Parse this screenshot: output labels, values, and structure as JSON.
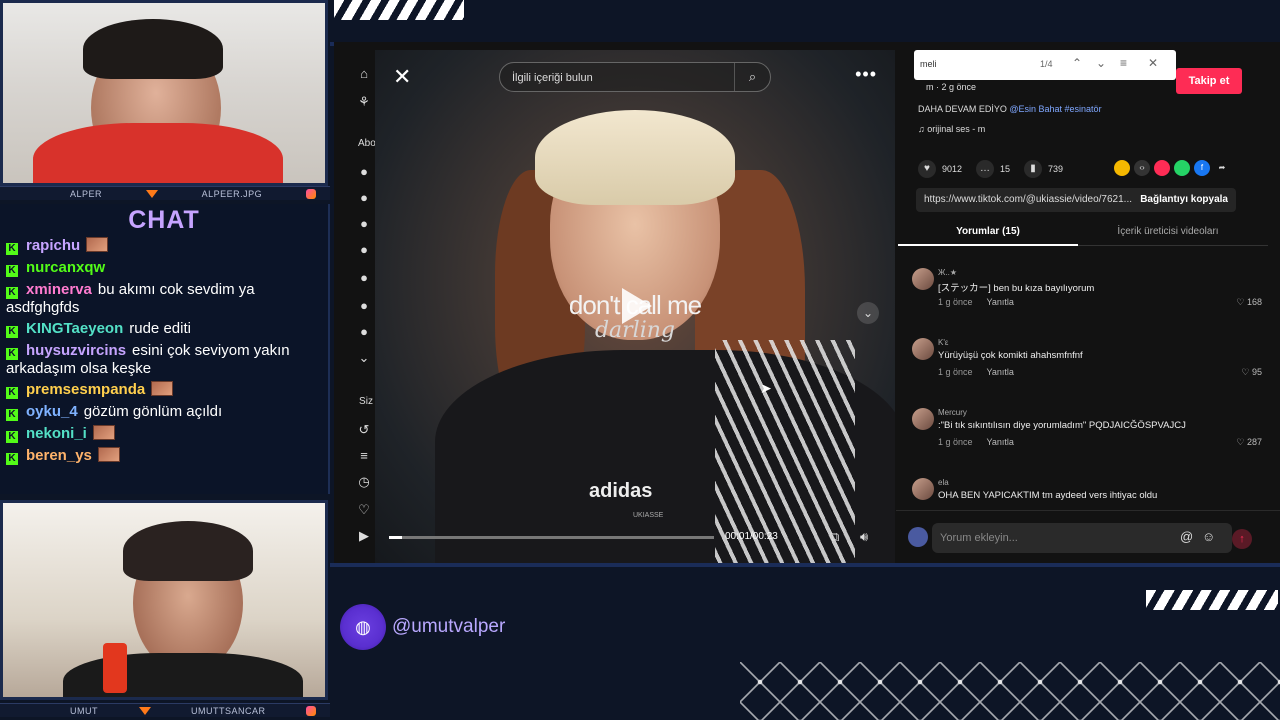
{
  "stream": {
    "cam1_name_left": "ALPER",
    "cam1_name_right": "ALPEER.JPG",
    "cam2_name_left": "UMUT",
    "cam2_name_right": "UMUTTSANCAR",
    "social_handle": "@umutvalper"
  },
  "chat": {
    "title": "CHAT",
    "messages": [
      {
        "user": "rapichu",
        "color": "#c6a4ff",
        "text": "",
        "emote": true
      },
      {
        "user": "nurcanxqw",
        "color": "#53fc18",
        "text": "",
        "emote": false
      },
      {
        "user": "xminerva",
        "color": "#ff7bd0",
        "text": "bu akımı cok sevdim ya asdfghgfds",
        "emote": false
      },
      {
        "user": "KINGTaeyeon",
        "color": "#53e0c6",
        "text": "rude editi",
        "emote": false
      },
      {
        "user": "huysuzvircins",
        "color": "#c6a4ff",
        "text": "esini çok seviyom yakın arkadaşım olsa keşke",
        "emote": false
      },
      {
        "user": "premsesmpanda",
        "color": "#ffcf4d",
        "text": "",
        "emote": true
      },
      {
        "user": "oyku_4",
        "color": "#7fb2ff",
        "text": "gözüm gönlüm açıldı",
        "emote": false
      },
      {
        "user": "nekoni_i",
        "color": "#53e0c6",
        "text": "",
        "emote": true
      },
      {
        "user": "beren_ys",
        "color": "#ffb36b",
        "text": "",
        "emote": true
      }
    ]
  },
  "video": {
    "search_placeholder": "İlgili içeriği bulun",
    "overlay_line1": "don't call me",
    "overlay_line2": "darling",
    "shirt_brand": "adidas",
    "watermark": "UKIASSE",
    "time": "00:01/00:23",
    "progress": 0.04
  },
  "sidebar": {
    "section1": "Abo",
    "section2": "Siz"
  },
  "panel": {
    "find_query": "meli",
    "find_count": "1/4",
    "follow_label": "Takip et",
    "author_line": "m · 2 g önce",
    "caption": "DAHA DEVAM EDİYO",
    "caption_tags": "@Esin Bahat #esinatör",
    "sound": "orijinal ses - m",
    "likes": "9012",
    "comments": "15",
    "saves": "739",
    "link": "https://www.tiktok.com/@ukiassie/video/7621...",
    "copy_label": "Bağlantıyı kopyala",
    "tab_comments": "Yorumlar (15)",
    "tab_creator": "İçerik üreticisi videoları",
    "input_placeholder": "Yorum ekleyin...",
    "comment_list": [
      {
        "name": "Ж..★",
        "text": "[ステッカー] ben bu kıza bayılıyorum",
        "time": "1 g önce",
        "reply": "Yanıtla",
        "likes": "168"
      },
      {
        "name": "K'ε",
        "text": "Yürüyüşü çok komikti ahahsmfnfnf",
        "time": "1 g önce",
        "reply": "Yanıtla",
        "likes": "95"
      },
      {
        "name": "Mercury",
        "text": ":\"Bi tık sıkıntılısın diye yorumladım\" PQDJAICĞÖSPVAJCJ",
        "time": "1 g önce",
        "reply": "Yanıtla",
        "likes": "287"
      },
      {
        "name": "ela",
        "text": "OHA BEN YAPICAKTIM tm aydeed vers ihtiyac oldu",
        "time": "",
        "reply": "",
        "likes": ""
      }
    ]
  }
}
